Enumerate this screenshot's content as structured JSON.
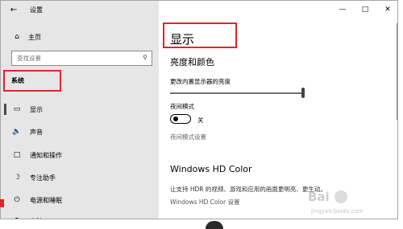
{
  "app": {
    "title": "设置",
    "back_icon": "back-arrow-icon",
    "window_controls": [
      "minimize-icon",
      "maximize-icon",
      "close-icon"
    ]
  },
  "sidebar": {
    "home_label": "主页",
    "search_placeholder": "查找设置",
    "section_label": "系统",
    "items": [
      {
        "icon": "display-icon",
        "label": "显示",
        "selected": true
      },
      {
        "icon": "sound-icon",
        "label": "声音",
        "selected": false
      },
      {
        "icon": "notifications-icon",
        "label": "通知和操作",
        "selected": false
      },
      {
        "icon": "focus-assist-icon",
        "label": "专注助手",
        "selected": false
      },
      {
        "icon": "power-icon",
        "label": "电源和睡眠",
        "selected": false
      },
      {
        "icon": "battery-icon",
        "label": "电池",
        "selected": false
      }
    ]
  },
  "main": {
    "page_title": "显示",
    "brightness_section_title": "亮度和颜色",
    "brightness_label": "更改内置显示器的亮度",
    "brightness_value": 1.0,
    "night_mode_label": "夜间模式",
    "night_mode_state": "关",
    "night_mode_link": "夜间模式设置",
    "hd_color_title": "Windows HD Color",
    "hd_color_desc": "让支持 HDR 的视频、游戏和应用的画面更明亮、更生动。",
    "hd_color_link": "Windows HD Color 设置"
  },
  "watermark": {
    "logo": "Bai",
    "url": "jingyan.baidu.com"
  },
  "colors": {
    "highlight_border": "#e0242a",
    "sidebar_bg": "#e6e6e6"
  }
}
